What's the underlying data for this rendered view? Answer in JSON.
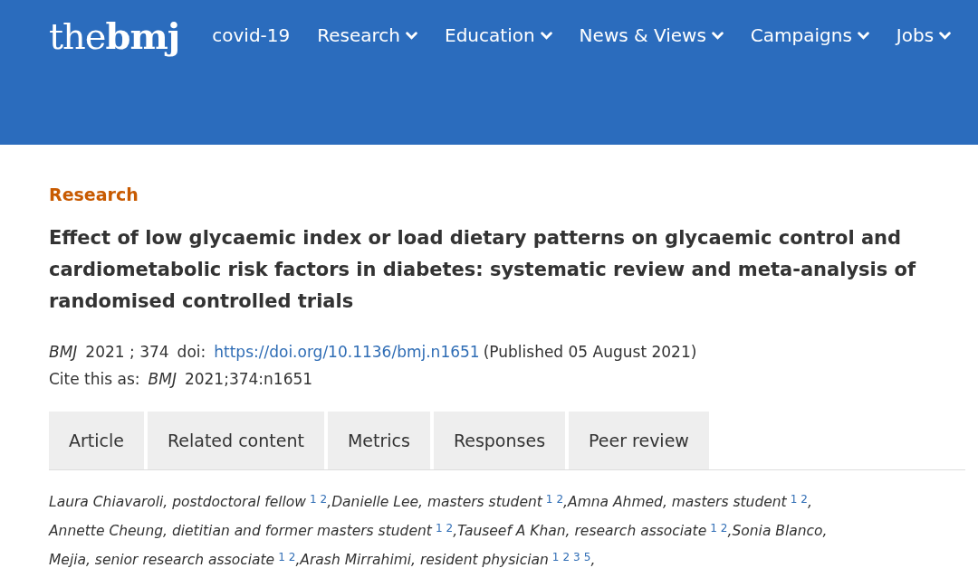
{
  "header": {
    "logo": {
      "light": "the",
      "bold": "bmj"
    },
    "nav": [
      {
        "label": "covid-19",
        "has_menu": false
      },
      {
        "label": "Research",
        "has_menu": true
      },
      {
        "label": "Education",
        "has_menu": true
      },
      {
        "label": "News & Views",
        "has_menu": true
      },
      {
        "label": "Campaigns",
        "has_menu": true
      },
      {
        "label": "Jobs",
        "has_menu": true
      }
    ]
  },
  "article": {
    "section": "Research",
    "title": "Effect of low glycaemic index or load dietary patterns on glycaemic control and cardiometabolic risk factors in diabetes: systematic review and meta-analysis of randomised controlled trials",
    "citation": {
      "journal": "BMJ",
      "year_volume": "2021 ; 374",
      "doi_label": "doi:",
      "doi_link": "https://doi.org/10.1136/bmj.n1651",
      "published": "(Published 05 August 2021)"
    },
    "cite_as": {
      "label": "Cite this as:",
      "journal": "BMJ",
      "ref": "2021;374:n1651"
    },
    "tabs": [
      {
        "label": "Article",
        "selected": false
      },
      {
        "label": "Related content",
        "selected": false
      },
      {
        "label": "Metrics",
        "selected": false
      },
      {
        "label": "Responses",
        "selected": false
      },
      {
        "label": "Peer review",
        "selected": false
      }
    ],
    "author_lines": [
      [
        {
          "text": "Laura Chiavaroli, postdoctoral fellow",
          "refs": [
            "1",
            "2"
          ]
        },
        {
          "text": ",Danielle Lee, masters student",
          "refs": [
            "1",
            "2"
          ]
        },
        {
          "text": ",Amna Ahmed, masters student",
          "refs": [
            "1",
            "2"
          ]
        },
        {
          "text": ","
        }
      ],
      [
        {
          "text": "Annette Cheung, dietitian and former masters student",
          "refs": [
            "1",
            "2"
          ]
        },
        {
          "text": ",Tauseef A Khan, research associate",
          "refs": [
            "1",
            "2"
          ]
        },
        {
          "text": ",Sonia Blanco,"
        }
      ],
      [
        {
          "text": "Mejia, senior research associate",
          "refs": [
            "1",
            "2"
          ]
        },
        {
          "text": ",Arash Mirrahimi, resident physician",
          "refs": [
            "1",
            "2",
            "3",
            "5"
          ]
        },
        {
          "text": ","
        }
      ]
    ]
  }
}
